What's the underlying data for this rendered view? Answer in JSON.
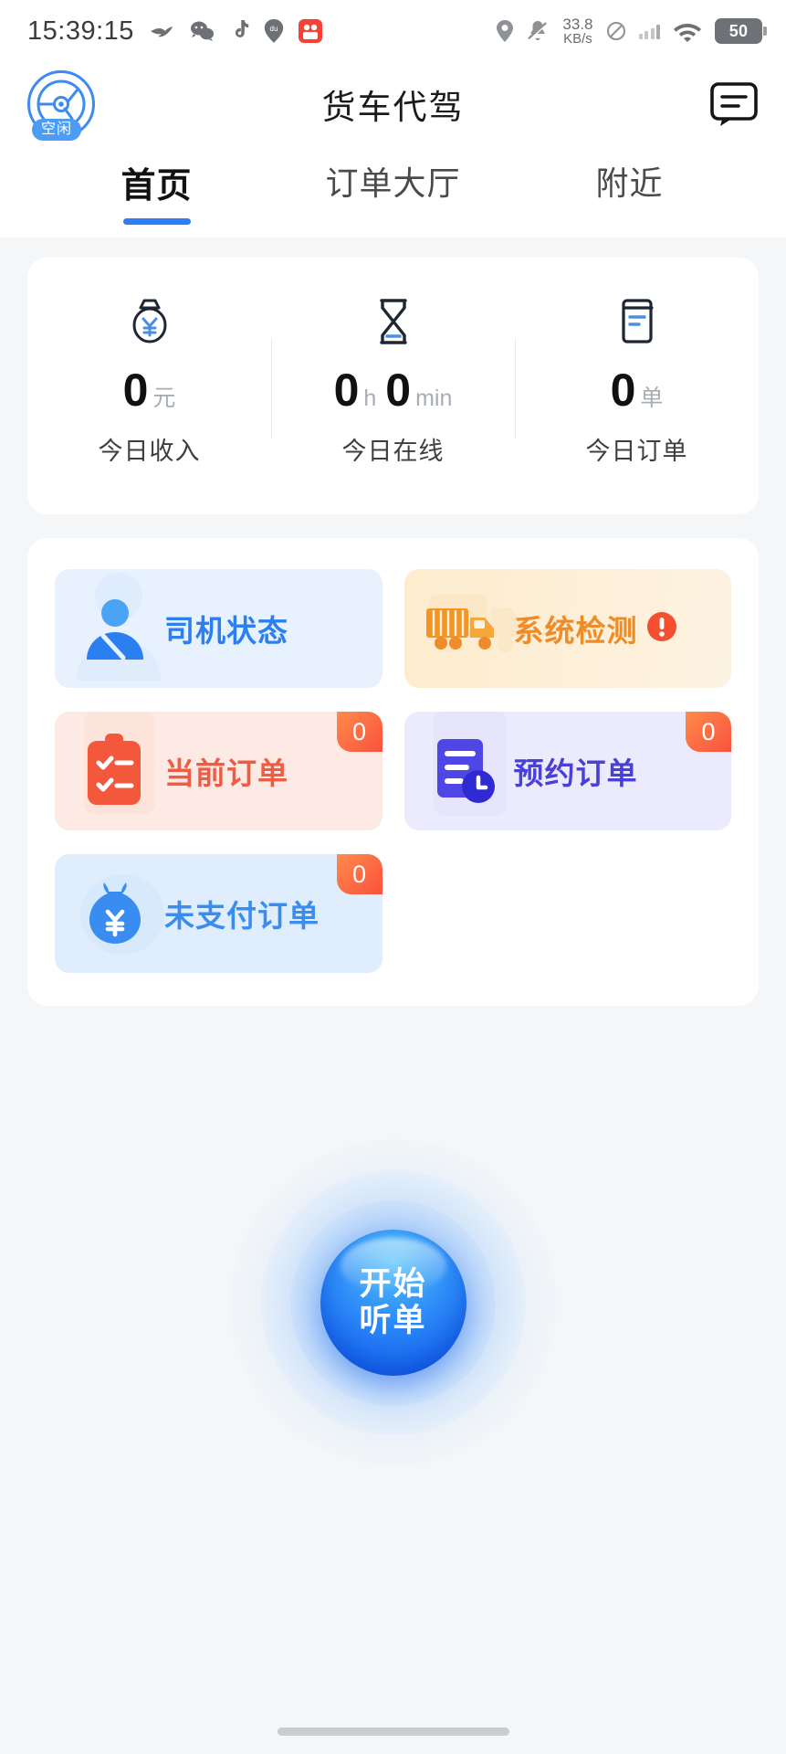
{
  "status_bar": {
    "clock": "15:39:15",
    "tray_icons": [
      "bird-app-icon",
      "wechat-icon",
      "tiktok-icon",
      "baidu-map-icon",
      "kuaishou-icon"
    ],
    "location_icon": "location-pin-icon",
    "mute_icon": "bell-muted-icon",
    "net_speed_value": "33.8",
    "net_speed_unit": "KB/s",
    "dnd_icon": "do-not-disturb-icon",
    "signal_icon": "signal-bars-icon",
    "wifi_icon": "wifi-icon",
    "battery_level": "50"
  },
  "header": {
    "title": "货车代驾",
    "avatar_status": "空闲",
    "avatar_icon": "driver-steering-wheel-icon",
    "chat_icon": "chat-bubble-icon"
  },
  "tabs": [
    {
      "label": "首页",
      "active": true
    },
    {
      "label": "订单大厅",
      "active": false
    },
    {
      "label": "附近",
      "active": false
    }
  ],
  "stats": [
    {
      "icon": "money-bag-yuan-icon",
      "value": "0",
      "unit": "元",
      "label": "今日收入"
    },
    {
      "icon": "hourglass-icon",
      "value": "0",
      "unit": "h",
      "value2": "0",
      "unit2": "min",
      "label": "今日在线"
    },
    {
      "icon": "order-document-icon",
      "value": "0",
      "unit": "单",
      "label": "今日订单"
    }
  ],
  "tiles": [
    {
      "label": "司机状态",
      "icon": "driver-person-icon",
      "badge": null,
      "warn": false
    },
    {
      "label": "系统检测",
      "icon": "truck-icon",
      "badge": null,
      "warn": true
    },
    {
      "label": "当前订单",
      "icon": "clipboard-checklist-icon",
      "badge": "0",
      "warn": false
    },
    {
      "label": "预约订单",
      "icon": "document-clock-icon",
      "badge": "0",
      "warn": false
    },
    {
      "label": "未支付订单",
      "icon": "money-bag-icon",
      "badge": "0",
      "warn": false
    }
  ],
  "listen_button": {
    "line1": "开始",
    "line2": "听单"
  },
  "colors": {
    "accent_blue": "#2f7df5",
    "orange": "#ef8c2a",
    "red": "#ef5c44",
    "purple": "#4840d8",
    "badge_gradient_from": "#ff8a4b",
    "badge_gradient_to": "#f9523e"
  }
}
